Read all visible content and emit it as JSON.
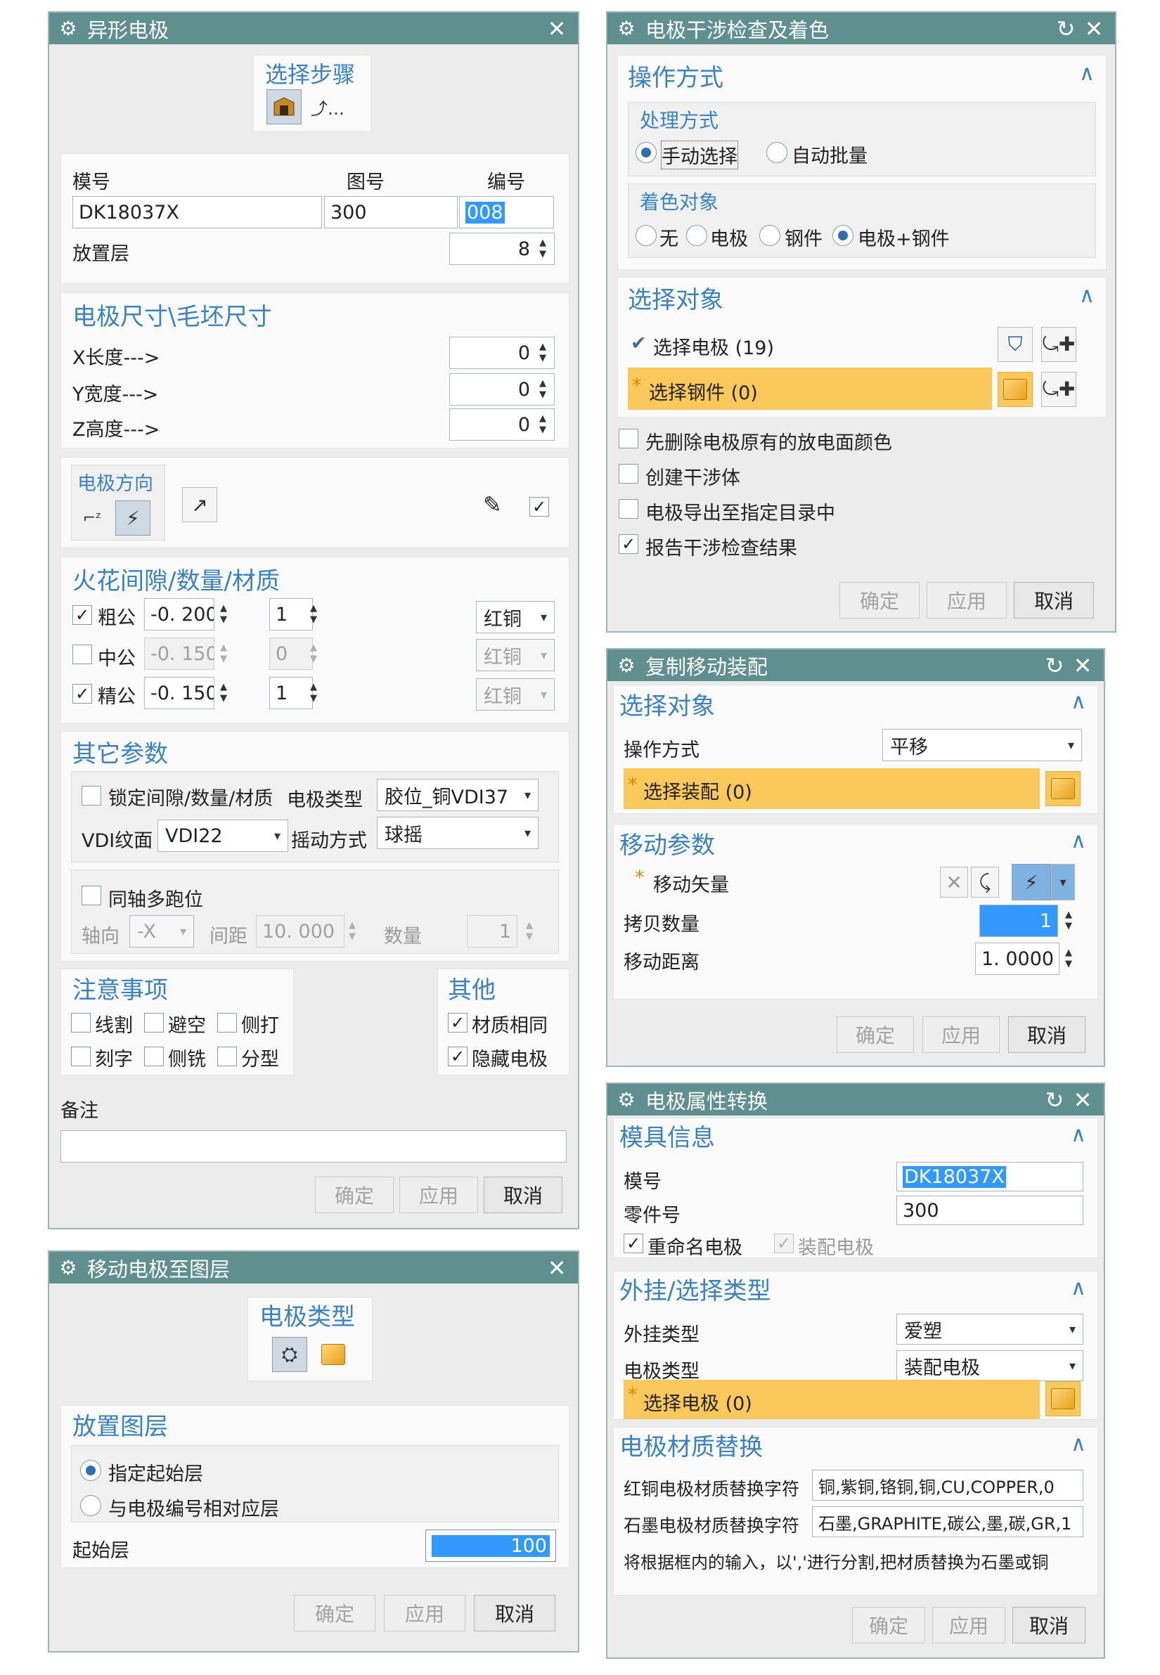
{
  "d1": {
    "title": "异形电极",
    "steps_label": "选择步骤",
    "mold_label": "模号",
    "drawing_label": "图号",
    "number_label": "编号",
    "mold_value": "DK18037X",
    "drawing_value": "300",
    "number_value": "008",
    "layer_label": "放置层",
    "layer_value": "8",
    "size_header": "电极尺寸\\毛坯尺寸",
    "x_label": "X长度--->",
    "y_label": "Y宽度--->",
    "z_label": "Z高度--->",
    "x_value": "0",
    "y_value": "0",
    "z_value": "0",
    "direction_label": "电极方向",
    "spark_header": "火花间隙/数量/材质",
    "spark_rows": [
      {
        "label": "粗公",
        "gap": "-0. 200(",
        "count": "1",
        "material": "红铜"
      },
      {
        "label": "中公",
        "gap": "-0. 150(",
        "count": "0",
        "material": "红铜"
      },
      {
        "label": "精公",
        "gap": "-0. 150(",
        "count": "1",
        "material": "红铜"
      }
    ],
    "other_header": "其它参数",
    "lock_label": "锁定间隙/数量/材质",
    "etype_label": "电极类型",
    "etype_value": "胶位_铜VDI37",
    "vdi_label": "VDI纹面",
    "vdi_value": "VDI22",
    "swing_label": "摇动方式",
    "swing_value": "球摇",
    "coaxial_label": "同轴多跑位",
    "axis_label": "轴向",
    "axis_value": "-X",
    "spacing_label": "间距",
    "spacing_value": "10. 000",
    "qty_label": "数量",
    "qty_value": "1",
    "notes_header": "注意事项",
    "notes": [
      "线割",
      "避空",
      "侧打",
      "刻字",
      "侧铣",
      "分型"
    ],
    "others_header": "其他",
    "others": [
      "材质相同",
      "隐藏电极"
    ],
    "remark_label": "备注",
    "ok": "确定",
    "apply": "应用",
    "cancel": "取消"
  },
  "d2": {
    "title": "电极干涉检查及着色",
    "op_header": "操作方式",
    "proc_label": "处理方式",
    "manual": "手动选择",
    "auto": "自动批量",
    "color_label": "着色对象",
    "c_none": "无",
    "c_elec": "电极",
    "c_steel": "钢件",
    "c_both": "电极+钢件",
    "sel_header": "选择对象",
    "sel_elec": "选择电极 (19)",
    "sel_steel": "选择钢件 (0)",
    "opts": [
      "先删除电极原有的放电面颜色",
      "创建干涉体",
      "电极导出至指定目录中",
      "报告干涉检查结果"
    ],
    "ok": "确定",
    "apply": "应用",
    "cancel": "取消"
  },
  "d3": {
    "title": "复制移动装配",
    "sel_header": "选择对象",
    "op_label": "操作方式",
    "op_value": "平移",
    "sel_asm": "选择装配 (0)",
    "move_header": "移动参数",
    "vec_label": "移动矢量",
    "copies_label": "拷贝数量",
    "copies_value": "1",
    "dist_label": "移动距离",
    "dist_value": "1. 0000",
    "ok": "确定",
    "apply": "应用",
    "cancel": "取消"
  },
  "d4": {
    "title": "电极属性转换",
    "mold_header": "模具信息",
    "mold_label": "模号",
    "mold_value": "DK18037X",
    "part_label": "零件号",
    "part_value": "300",
    "rename": "重命名电极",
    "asm": "装配电极",
    "ext_header": "外挂/选择类型",
    "ext_label": "外挂类型",
    "ext_value": "爱塑",
    "etype_label": "电极类型",
    "etype_value": "装配电极",
    "sel_elec": "选择电极 (0)",
    "mat_header": "电极材质替换",
    "cu_label": "红铜电极材质替换字符",
    "cu_value": "铜,紫铜,铬铜,铜,CU,COPPER,0",
    "gr_label": "石墨电极材质替换字符",
    "gr_value": "石墨,GRAPHITE,碳公,墨,碳,GR,1",
    "note": "将根据框内的输入，以','进行分割,把材质替换为石墨或铜",
    "ok": "确定",
    "apply": "应用",
    "cancel": "取消"
  },
  "d5": {
    "title": "移动电极至图层",
    "type_header": "电极类型",
    "layer_header": "放置图层",
    "opt1": "指定起始层",
    "opt2": "与电极编号相对应层",
    "start_label": "起始层",
    "start_value": "100",
    "ok": "确定",
    "apply": "应用",
    "cancel": "取消"
  },
  "icons": {
    "gear": "⚙",
    "close": "✕",
    "reset": "↻",
    "caret": "∧",
    "check": "✓",
    "dropdown": "▾",
    "spin_up": "▲",
    "spin_down": "▼"
  },
  "colors": {
    "titlebar": "#5f8f8e",
    "accent": "#3b83c0",
    "required": "#fbc95b",
    "selection": "#3399ff"
  }
}
